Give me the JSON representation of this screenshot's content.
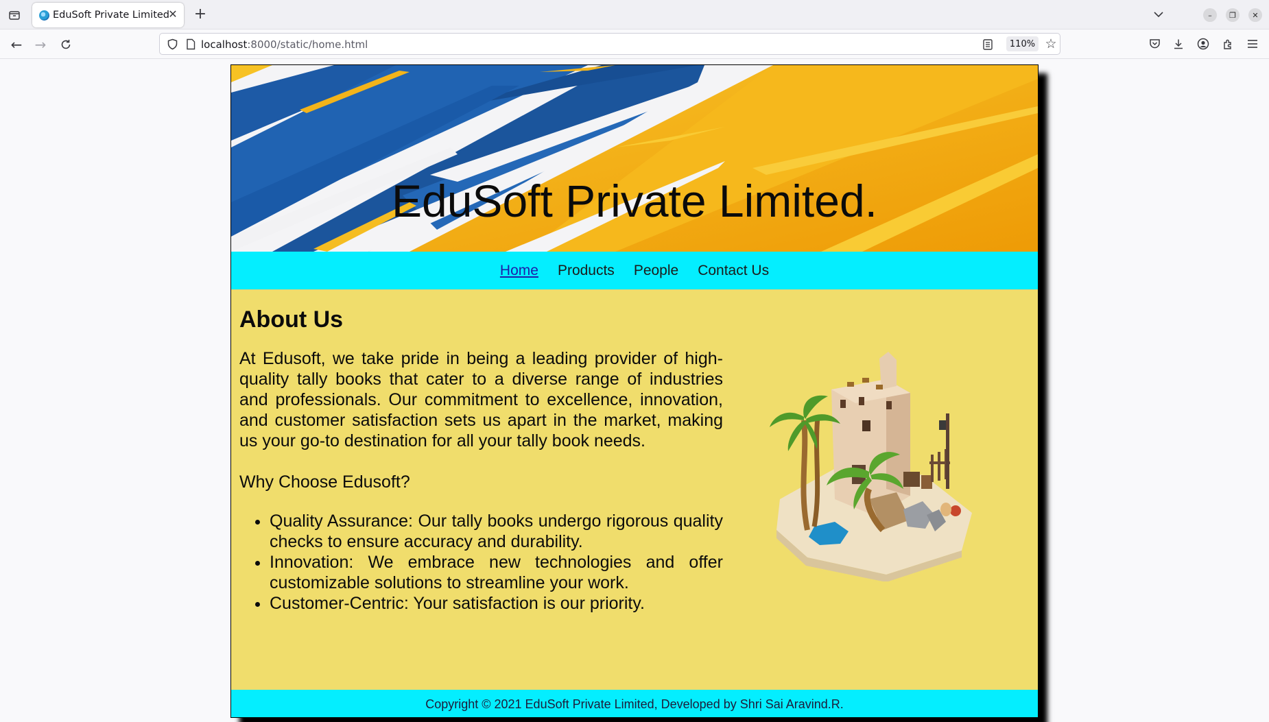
{
  "browser": {
    "tab_title": "EduSoft Private Limited",
    "url_host": "localhost",
    "url_path": ":8000/static/home.html",
    "zoom": "110%"
  },
  "site": {
    "banner_title": "EduSoft Private Limited.",
    "nav": [
      {
        "label": "Home",
        "active": true
      },
      {
        "label": "Products",
        "active": false
      },
      {
        "label": "People",
        "active": false
      },
      {
        "label": "Contact Us",
        "active": false
      }
    ],
    "about": {
      "heading": "About Us",
      "paragraph": "At Edusoft, we take pride in being a leading provider of high-quality tally books that cater to a diverse range of industries and professionals. Our commitment to excellence, innovation, and customer satisfaction sets us apart in the market, making us your go-to destination for all your tally book needs.",
      "why": "Why Choose Edusoft?",
      "features": [
        "Quality Assurance: Our tally books undergo rigorous quality checks to ensure accuracy and durability.",
        "Innovation: We embrace new technologies and offer customizable solutions to streamline your work.",
        "Customer-Centric: Your satisfaction is our priority."
      ]
    },
    "footer": "Copyright © 2021 EduSoft Private Limited, Developed by Shri Sai Aravind.R.",
    "colors": {
      "nav_background": "#04eeff",
      "content_background": "#f0dd6c",
      "banner_blue": "#1a5fae",
      "banner_yellow": "#f5b418"
    }
  }
}
